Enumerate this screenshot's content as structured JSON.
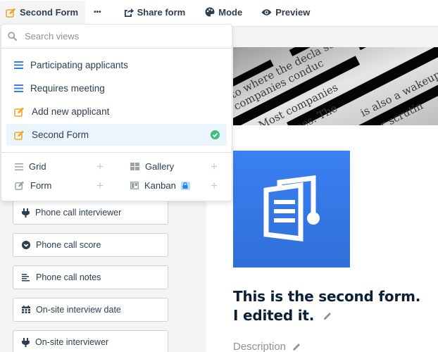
{
  "toolbar": {
    "current_view": "Second Form",
    "more_label": "•••",
    "share_label": "Share form",
    "mode_label": "Mode",
    "preview_label": "Preview"
  },
  "view_menu": {
    "search_placeholder": "Search views",
    "search_value": "",
    "views": [
      {
        "label": "Participating applicants",
        "icon": "list-icon",
        "active": false
      },
      {
        "label": "Requires meeting",
        "icon": "list-icon",
        "active": false
      },
      {
        "label": "Add new applicant",
        "icon": "form-edit-icon",
        "active": false
      },
      {
        "label": "Second Form",
        "icon": "form-edit-icon",
        "active": true
      }
    ],
    "create_types": [
      {
        "label": "Grid",
        "icon": "grid-icon",
        "locked": false
      },
      {
        "label": "Gallery",
        "icon": "gallery-icon",
        "locked": false
      },
      {
        "label": "Form",
        "icon": "form-icon",
        "locked": false
      },
      {
        "label": "Kanban",
        "icon": "kanban-icon",
        "locked": true
      }
    ],
    "add_symbol": "+"
  },
  "fields": [
    {
      "label": "Phone call interviewer",
      "icon": "plug-icon"
    },
    {
      "label": "Phone call score",
      "icon": "chevron-circle-icon"
    },
    {
      "label": "Phone call notes",
      "icon": "text-lines-icon"
    },
    {
      "label": "On-site interview date",
      "icon": "calendar-icon"
    },
    {
      "label": "On-site interviewer",
      "icon": "plug-icon"
    }
  ],
  "form": {
    "title": "This is the second form. I edited it.",
    "description_placeholder": "Description"
  },
  "colors": {
    "accent_blue": "#2f80ed",
    "form_orange": "#f5a623",
    "success_green": "#3fbf7f",
    "active_bg": "#eaf5fd"
  }
}
